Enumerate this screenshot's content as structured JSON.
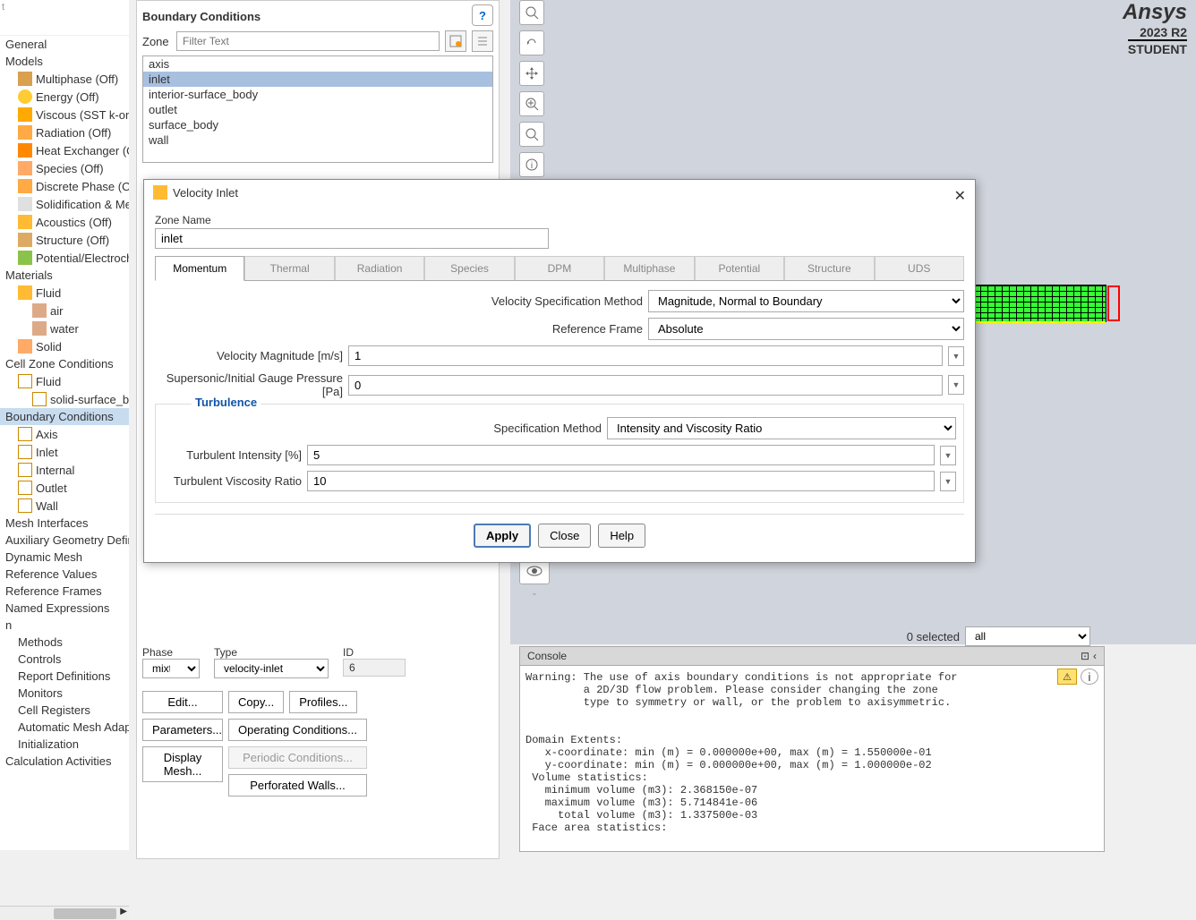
{
  "tree": {
    "general": "General",
    "models": "Models",
    "multiphase": "Multiphase (Off)",
    "energy": "Energy (Off)",
    "viscous": "Viscous (SST k-omeg",
    "radiation": "Radiation (Off)",
    "heat_exchanger": "Heat Exchanger (Off)",
    "species": "Species (Off)",
    "discrete_phase": "Discrete Phase (Off)",
    "solidification": "Solidification & Melti",
    "acoustics": "Acoustics (Off)",
    "structure": "Structure (Off)",
    "potential": "Potential/Electrochen",
    "materials": "Materials",
    "fluid": "Fluid",
    "air": "air",
    "water": "water",
    "solid": "Solid",
    "cell_zone": "Cell Zone Conditions",
    "fluid2": "Fluid",
    "solid_surf": "solid-surface_bo",
    "boundary_conditions": "Boundary Conditions",
    "axis": "Axis",
    "inlet": "Inlet",
    "internal": "Internal",
    "outlet": "Outlet",
    "wall": "Wall",
    "mesh_interfaces": "Mesh Interfaces",
    "aux_geometry": "Auxiliary Geometry Defini",
    "dynamic_mesh": "Dynamic Mesh",
    "reference_values": "Reference Values",
    "reference_frames": "Reference Frames",
    "named_expressions": "Named Expressions",
    "n": "n",
    "methods": "Methods",
    "controls": "Controls",
    "report_defs": "Report Definitions",
    "monitors": "Monitors",
    "cell_registers": "Cell Registers",
    "auto_mesh": "Automatic Mesh Adaption",
    "initialization": "Initialization",
    "calc_activities": "Calculation Activities"
  },
  "bc_panel": {
    "title": "Boundary Conditions",
    "zone_label": "Zone",
    "filter_placeholder": "Filter Text",
    "zones": [
      "axis",
      "inlet",
      "interior-surface_body",
      "outlet",
      "surface_body",
      "wall"
    ],
    "phase_label": "Phase",
    "phase_value": "mixture",
    "type_label": "Type",
    "type_value": "velocity-inlet",
    "id_label": "ID",
    "id_value": "6",
    "edit": "Edit...",
    "copy": "Copy...",
    "profiles": "Profiles...",
    "parameters": "Parameters...",
    "operating": "Operating Conditions...",
    "display_mesh": "Display Mesh...",
    "periodic": "Periodic Conditions...",
    "perforated": "Perforated Walls..."
  },
  "dialog": {
    "title": "Velocity Inlet",
    "zone_name_label": "Zone Name",
    "zone_name_value": "inlet",
    "tabs": [
      "Momentum",
      "Thermal",
      "Radiation",
      "Species",
      "DPM",
      "Multiphase",
      "Potential",
      "Structure",
      "UDS"
    ],
    "velocity_spec_label": "Velocity Specification Method",
    "velocity_spec_value": "Magnitude, Normal to Boundary",
    "ref_frame_label": "Reference Frame",
    "ref_frame_value": "Absolute",
    "velocity_mag_label": "Velocity Magnitude [m/s]",
    "velocity_mag_value": "1",
    "supersonic_label": "Supersonic/Initial Gauge Pressure [Pa]",
    "supersonic_value": "0",
    "turbulence_title": "Turbulence",
    "spec_method_label": "Specification Method",
    "spec_method_value": "Intensity and Viscosity Ratio",
    "turb_intensity_label": "Turbulent Intensity [%]",
    "turb_intensity_value": "5",
    "turb_ratio_label": "Turbulent Viscosity Ratio",
    "turb_ratio_value": "10",
    "apply": "Apply",
    "close": "Close",
    "help": "Help"
  },
  "logo": {
    "name": "Ansys",
    "version": "2023 R2",
    "student": "STUDENT"
  },
  "status": {
    "selected": "0 selected",
    "dropdown": "all"
  },
  "console": {
    "title": "Console",
    "text": "Warning: The use of axis boundary conditions is not appropriate for\n         a 2D/3D flow problem. Please consider changing the zone\n         type to symmetry or wall, or the problem to axisymmetric.\n\n\nDomain Extents:\n   x-coordinate: min (m) = 0.000000e+00, max (m) = 1.550000e-01\n   y-coordinate: min (m) = 0.000000e+00, max (m) = 1.000000e-02\n Volume statistics:\n   minimum volume (m3): 2.368150e-07\n   maximum volume (m3): 5.714841e-06\n     total volume (m3): 1.337500e-03\n Face area statistics:"
  }
}
